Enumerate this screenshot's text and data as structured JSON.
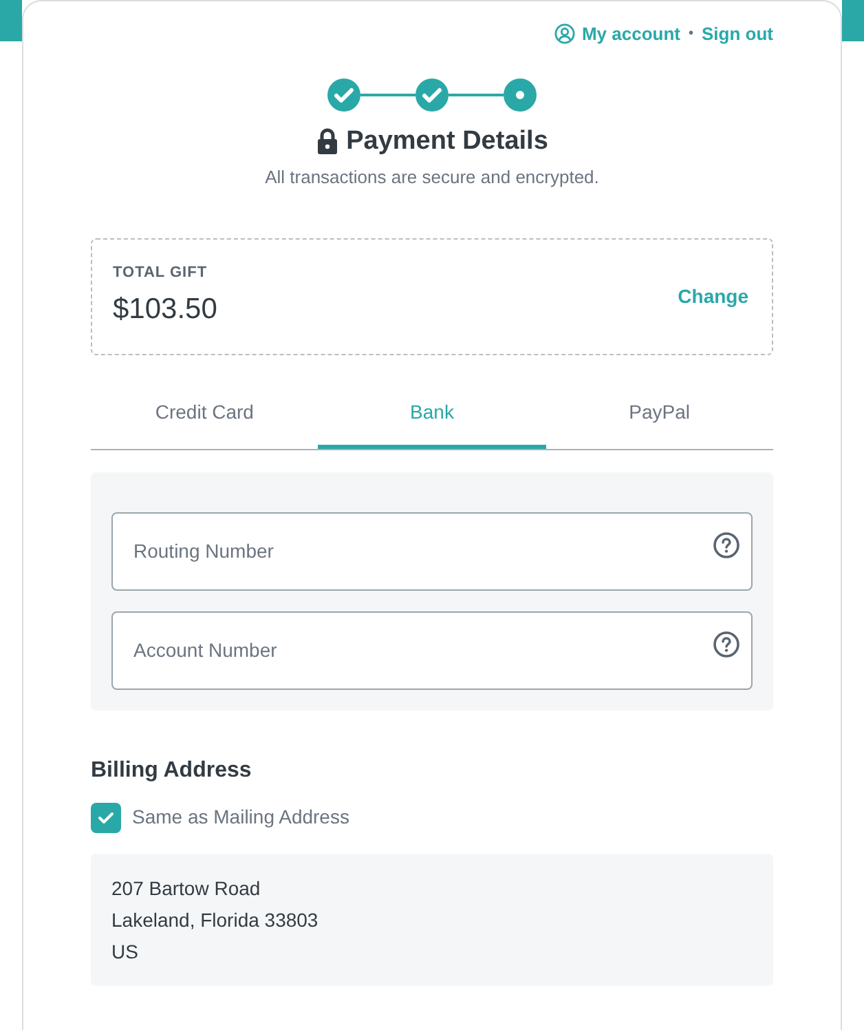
{
  "account_links": [
    {
      "label": "My account",
      "kind": "account"
    },
    {
      "label": "Sign out",
      "kind": "plain"
    }
  ],
  "separator": "•",
  "steps": [
    {
      "completed": true
    },
    {
      "completed": true
    },
    {
      "completed": false
    }
  ],
  "title": "Payment Details",
  "subtitle": "All transactions are secure and encrypted.",
  "total": {
    "label": "TOTAL GIFT",
    "amount": "$103.50",
    "action": "Change"
  },
  "tabs": [
    {
      "label": "Credit Card",
      "selected": false
    },
    {
      "label": "Bank",
      "selected": true
    },
    {
      "label": "PayPal",
      "selected": false
    }
  ],
  "fields": [
    {
      "placeholder": "Routing Number"
    },
    {
      "placeholder": "Account Number"
    }
  ],
  "billing": {
    "heading": "Billing Address",
    "same_as_mailing": {
      "label": "Same as Mailing Address",
      "checked": true
    },
    "address_lines": [
      "207 Bartow Road",
      "Lakeland, Florida 33803",
      "US"
    ]
  }
}
